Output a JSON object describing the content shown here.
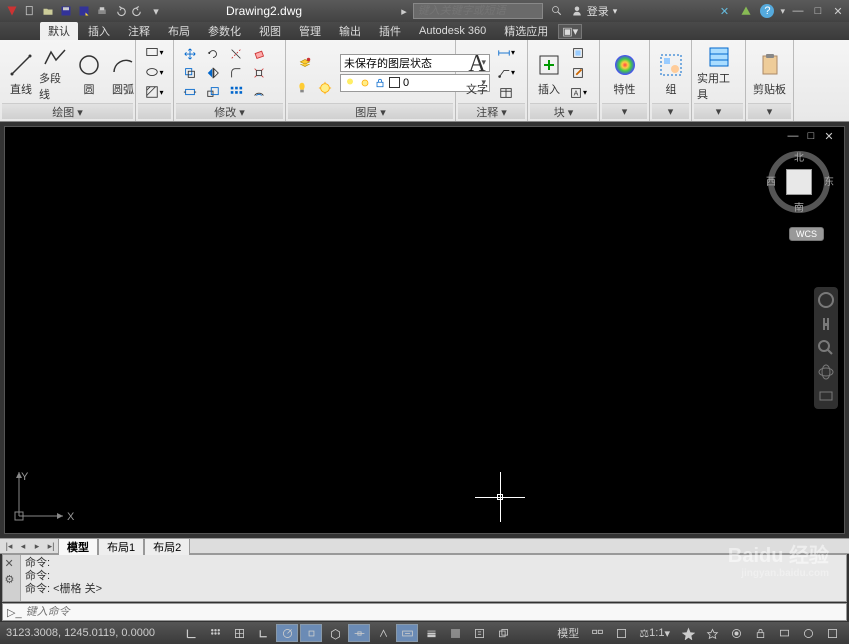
{
  "title": "Drawing2.dwg",
  "search_placeholder": "键入关键字或短语",
  "login_text": "登录",
  "qat_dropdown": "▾",
  "win_help": "?",
  "menus": {
    "m0": "默认",
    "m1": "插入",
    "m2": "注释",
    "m3": "布局",
    "m4": "参数化",
    "m5": "视图",
    "m6": "管理",
    "m7": "输出",
    "m8": "插件",
    "m9": "Autodesk 360",
    "m10": "精选应用"
  },
  "big_tools": {
    "line": "直线",
    "polyline": "多段线",
    "circle": "圆",
    "arc": "圆弧",
    "text": "文字",
    "insert": "插入",
    "props": "特性",
    "group": "组",
    "utils": "实用工具",
    "clipboard": "剪贴板"
  },
  "panel_titles": {
    "draw": "绘图 ▾",
    "modify": "修改 ▾",
    "layers": "图层 ▾",
    "annot": "注释 ▾",
    "block": "块 ▾"
  },
  "layer_state": "未保存的图层状态",
  "layer_current": "0",
  "text_A": "A",
  "viewcube": {
    "n": "北",
    "s": "南",
    "e": "东",
    "w": "西"
  },
  "wcs": "WCS",
  "axes": {
    "x": "X",
    "y": "Y"
  },
  "tabs": {
    "nav_first": "|◂",
    "nav_prev": "◂",
    "nav_next": "▸",
    "nav_last": "▸|",
    "model": "模型",
    "l1": "布局1",
    "l2": "布局2"
  },
  "cmd": {
    "l1": "命令:",
    "l2": "命令:",
    "l3": "命令: <栅格 关>",
    "placeholder": "键入命令",
    "prompt": "▷_"
  },
  "coords": "3123.3008, 1245.0119, 0.0000",
  "status_model": "模型",
  "status_scale": "1:1",
  "watermark": {
    "main": "Baidu 经验",
    "sub": "jingyan.baidu.com"
  }
}
